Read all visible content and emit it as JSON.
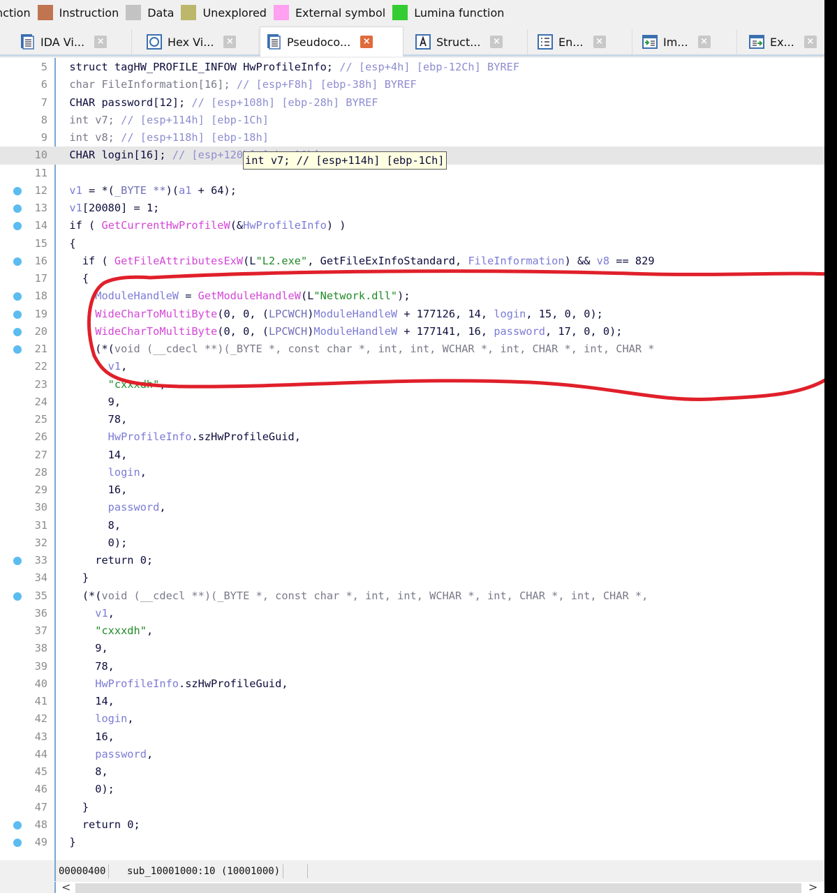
{
  "legend": [
    {
      "label": "nction",
      "color": null
    },
    {
      "label": "Instruction",
      "color": "#c0744f"
    },
    {
      "label": "Data",
      "color": "#c3c3c3"
    },
    {
      "label": "Unexplored",
      "color": "#bdb76b"
    },
    {
      "label": "External symbol",
      "color": "#ffa0f0"
    },
    {
      "label": "Lumina function",
      "color": "#33cc33"
    }
  ],
  "tabs": [
    {
      "label": "IDA Vi...",
      "icon": "listing-icon",
      "active": false
    },
    {
      "label": "Hex Vi...",
      "icon": "hex-view-icon",
      "active": false
    },
    {
      "label": "Pseudoco...",
      "icon": "pseudocode-icon",
      "active": true
    },
    {
      "label": "Struct...",
      "icon": "structures-icon",
      "active": false
    },
    {
      "label": "En...",
      "icon": "enums-icon",
      "active": false
    },
    {
      "label": "Im...",
      "icon": "imports-icon",
      "active": false
    },
    {
      "label": "Ex...",
      "icon": "exports-icon",
      "active": false
    }
  ],
  "code_lines": [
    {
      "n": "5",
      "bp": false,
      "segs": [
        [
          "kw",
          "struct tagHW_PROFILE_INFOW HwProfileInfo; "
        ],
        [
          "cm",
          "// [esp+4h] [ebp-12Ch] BYREF"
        ]
      ]
    },
    {
      "n": "6",
      "bp": false,
      "segs": [
        [
          "gray",
          "char FileInformation[16]; "
        ],
        [
          "cm",
          "// [esp+F8h] [ebp-38h] BYREF"
        ]
      ]
    },
    {
      "n": "7",
      "bp": false,
      "segs": [
        [
          "kw",
          "CHAR password[12]; "
        ],
        [
          "cm",
          "// [esp+108h] [ebp-28h] BYREF"
        ]
      ]
    },
    {
      "n": "8",
      "bp": false,
      "segs": [
        [
          "gray",
          "int v7; "
        ],
        [
          "cm",
          "// [esp+114h] [ebp-1Ch]"
        ]
      ]
    },
    {
      "n": "9",
      "bp": false,
      "segs": [
        [
          "gray",
          "int v8; "
        ],
        [
          "cm",
          "// [esp+118h] [ebp-18h]"
        ]
      ]
    },
    {
      "n": "10",
      "bp": false,
      "hl": true,
      "segs": [
        [
          "kw",
          "CHAR login[16]; "
        ],
        [
          "cm",
          "// [esp+120h] [ebp-10h]"
        ]
      ]
    },
    {
      "n": "11",
      "bp": false,
      "segs": []
    },
    {
      "n": "12",
      "bp": true,
      "segs": [
        [
          "var",
          "v1"
        ],
        [
          "kw",
          " = *("
        ],
        [
          "cast",
          "_BYTE **"
        ],
        [
          "kw",
          ")("
        ],
        [
          "var",
          "a1"
        ],
        [
          "kw",
          " + 64);"
        ]
      ]
    },
    {
      "n": "13",
      "bp": true,
      "segs": [
        [
          "var",
          "v1"
        ],
        [
          "kw",
          "[20080] = 1;"
        ]
      ]
    },
    {
      "n": "14",
      "bp": true,
      "segs": [
        [
          "kw",
          "if ( "
        ],
        [
          "fn",
          "GetCurrentHwProfileW"
        ],
        [
          "kw",
          "(&"
        ],
        [
          "var",
          "HwProfileInfo"
        ],
        [
          "kw",
          ") )"
        ]
      ]
    },
    {
      "n": "15",
      "bp": false,
      "segs": [
        [
          "kw",
          "{"
        ]
      ]
    },
    {
      "n": "16",
      "bp": true,
      "segs": [
        [
          "kw",
          "  if ( "
        ],
        [
          "fn",
          "GetFileAttributesExW"
        ],
        [
          "kw",
          "(L"
        ],
        [
          "str",
          "\"L2.exe\""
        ],
        [
          "kw",
          ", GetFileExInfoStandard, "
        ],
        [
          "var",
          "FileInformation"
        ],
        [
          "kw",
          ") && "
        ],
        [
          "var",
          "v8"
        ],
        [
          "kw",
          " == 829"
        ]
      ]
    },
    {
      "n": "17",
      "bp": false,
      "segs": [
        [
          "kw",
          "  {"
        ]
      ]
    },
    {
      "n": "18",
      "bp": true,
      "segs": [
        [
          "var",
          "    ModuleHandleW"
        ],
        [
          "kw",
          " = "
        ],
        [
          "fn",
          "GetModuleHandleW"
        ],
        [
          "kw",
          "(L"
        ],
        [
          "str",
          "\"Network.dll\""
        ],
        [
          "kw",
          ");"
        ]
      ]
    },
    {
      "n": "19",
      "bp": true,
      "segs": [
        [
          "fn",
          "    WideCharToMultiByte"
        ],
        [
          "kw",
          "(0, 0, ("
        ],
        [
          "cast",
          "LPCWCH"
        ],
        [
          "kw",
          ")"
        ],
        [
          "var",
          "ModuleHandleW"
        ],
        [
          "kw",
          " + 177126, 14, "
        ],
        [
          "var",
          "login"
        ],
        [
          "kw",
          ", 15, 0, 0);"
        ]
      ]
    },
    {
      "n": "20",
      "bp": true,
      "segs": [
        [
          "fn",
          "    WideCharToMultiByte"
        ],
        [
          "kw",
          "(0, 0, ("
        ],
        [
          "cast",
          "LPCWCH"
        ],
        [
          "kw",
          ")"
        ],
        [
          "var",
          "ModuleHandleW"
        ],
        [
          "kw",
          " + 177141, 16, "
        ],
        [
          "var",
          "password"
        ],
        [
          "kw",
          ", 17, 0, 0);"
        ]
      ]
    },
    {
      "n": "21",
      "bp": true,
      "segs": [
        [
          "kw",
          "    (*("
        ],
        [
          "gray",
          "void (__cdecl **)(_BYTE *, const char *, int, int, WCHAR *, int, CHAR *, int, CHAR *"
        ]
      ]
    },
    {
      "n": "22",
      "bp": false,
      "segs": [
        [
          "var",
          "      v1"
        ],
        [
          "kw",
          ","
        ]
      ]
    },
    {
      "n": "23",
      "bp": false,
      "segs": [
        [
          "str",
          "      \"cxxxdh\""
        ],
        [
          "kw",
          ","
        ]
      ]
    },
    {
      "n": "24",
      "bp": false,
      "segs": [
        [
          "kw",
          "      9,"
        ]
      ]
    },
    {
      "n": "25",
      "bp": false,
      "segs": [
        [
          "kw",
          "      78,"
        ]
      ]
    },
    {
      "n": "26",
      "bp": false,
      "segs": [
        [
          "var",
          "      HwProfileInfo"
        ],
        [
          "kw",
          ".szHwProfileGuid,"
        ]
      ]
    },
    {
      "n": "27",
      "bp": false,
      "segs": [
        [
          "kw",
          "      14,"
        ]
      ]
    },
    {
      "n": "28",
      "bp": false,
      "segs": [
        [
          "var",
          "      login"
        ],
        [
          "kw",
          ","
        ]
      ]
    },
    {
      "n": "29",
      "bp": false,
      "segs": [
        [
          "kw",
          "      16,"
        ]
      ]
    },
    {
      "n": "30",
      "bp": false,
      "segs": [
        [
          "var",
          "      password"
        ],
        [
          "kw",
          ","
        ]
      ]
    },
    {
      "n": "31",
      "bp": false,
      "segs": [
        [
          "kw",
          "      8,"
        ]
      ]
    },
    {
      "n": "32",
      "bp": false,
      "segs": [
        [
          "kw",
          "      0);"
        ]
      ]
    },
    {
      "n": "33",
      "bp": true,
      "segs": [
        [
          "kw",
          "    return 0;"
        ]
      ]
    },
    {
      "n": "34",
      "bp": false,
      "segs": [
        [
          "kw",
          "  }"
        ]
      ]
    },
    {
      "n": "35",
      "bp": true,
      "segs": [
        [
          "kw",
          "  (*("
        ],
        [
          "gray",
          "void (__cdecl **)(_BYTE *, const char *, int, int, WCHAR *, int, CHAR *, int, CHAR *,"
        ]
      ]
    },
    {
      "n": "36",
      "bp": false,
      "segs": [
        [
          "var",
          "    v1"
        ],
        [
          "kw",
          ","
        ]
      ]
    },
    {
      "n": "37",
      "bp": false,
      "segs": [
        [
          "str",
          "    \"cxxxdh\""
        ],
        [
          "kw",
          ","
        ]
      ]
    },
    {
      "n": "38",
      "bp": false,
      "segs": [
        [
          "kw",
          "    9,"
        ]
      ]
    },
    {
      "n": "39",
      "bp": false,
      "segs": [
        [
          "kw",
          "    78,"
        ]
      ]
    },
    {
      "n": "40",
      "bp": false,
      "segs": [
        [
          "var",
          "    HwProfileInfo"
        ],
        [
          "kw",
          ".szHwProfileGuid,"
        ]
      ]
    },
    {
      "n": "41",
      "bp": false,
      "segs": [
        [
          "kw",
          "    14,"
        ]
      ]
    },
    {
      "n": "42",
      "bp": false,
      "segs": [
        [
          "var",
          "    login"
        ],
        [
          "kw",
          ","
        ]
      ]
    },
    {
      "n": "43",
      "bp": false,
      "segs": [
        [
          "kw",
          "    16,"
        ]
      ]
    },
    {
      "n": "44",
      "bp": false,
      "segs": [
        [
          "var",
          "    password"
        ],
        [
          "kw",
          ","
        ]
      ]
    },
    {
      "n": "45",
      "bp": false,
      "segs": [
        [
          "kw",
          "    8,"
        ]
      ]
    },
    {
      "n": "46",
      "bp": false,
      "segs": [
        [
          "kw",
          "    0);"
        ]
      ]
    },
    {
      "n": "47",
      "bp": false,
      "segs": [
        [
          "kw",
          "  }"
        ]
      ]
    },
    {
      "n": "48",
      "bp": true,
      "segs": [
        [
          "kw",
          "  return 0;"
        ]
      ]
    },
    {
      "n": "49",
      "bp": true,
      "segs": [
        [
          "kw",
          "}"
        ]
      ]
    }
  ],
  "tooltip": {
    "text": "int v7; // [esp+114h] [ebp-1Ch]"
  },
  "status": {
    "offset": "00000400",
    "location": "sub_10001000:10 (10001000)"
  },
  "scroll": {
    "left_arrow": "<",
    "right_arrow": ">"
  },
  "annotation": {
    "color": "#e0202a",
    "description": "hand-drawn red circle around lines 17-23"
  }
}
